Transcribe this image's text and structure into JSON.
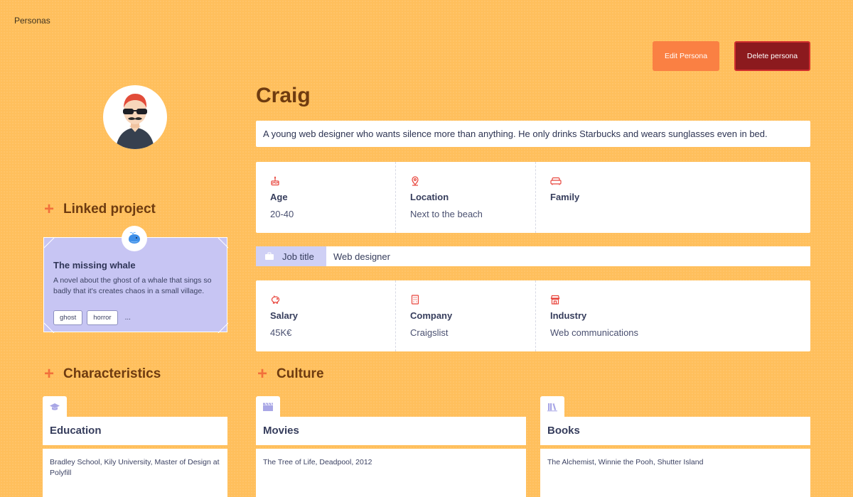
{
  "app": {
    "title": "Personas"
  },
  "actions": {
    "edit_label": "Edit Persona",
    "delete_label": "Delete persona"
  },
  "persona": {
    "name": "Craig",
    "description": "A young web designer who wants silence more than anything. He only drinks Starbucks and wears sunglasses even in bed.",
    "age": {
      "label": "Age",
      "value": "20-40",
      "icon": "cake-icon"
    },
    "location": {
      "label": "Location",
      "value": "Next to the beach",
      "icon": "location-pin-icon"
    },
    "family": {
      "label": "Family",
      "value": "",
      "icon": "sofa-icon"
    },
    "job": {
      "label": "Job title",
      "value": "Web designer",
      "icon": "briefcase-icon"
    },
    "salary": {
      "label": "Salary",
      "value": "45K€",
      "icon": "piggy-bank-icon"
    },
    "company": {
      "label": "Company",
      "value": "Craigslist",
      "icon": "building-icon"
    },
    "industry": {
      "label": "Industry",
      "value": "Web communications",
      "icon": "storefront-icon"
    }
  },
  "linked_project": {
    "heading": "Linked project",
    "title": "The missing whale",
    "description": "A novel about the ghost of a whale that sings so badly that it's creates chaos in a small village.",
    "emoji_icon": "whale-icon",
    "tags": [
      "ghost",
      "horror"
    ],
    "more": "..."
  },
  "characteristics": {
    "heading": "Characteristics",
    "education": {
      "label": "Education",
      "value": "Bradley School, Kily University, Master of Design at Polyfill",
      "icon": "graduation-cap-icon"
    }
  },
  "culture": {
    "heading": "Culture",
    "movies": {
      "label": "Movies",
      "value": "The Tree of Life, Deadpool, 2012",
      "icon": "clapperboard-icon"
    },
    "books": {
      "label": "Books",
      "value": "The Alchemist, Winnie the Pooh, Shutter Island",
      "icon": "books-icon"
    }
  },
  "colors": {
    "background": "#ffbf5c",
    "accent": "#fa8043",
    "danger": "#8c1a1e",
    "heading": "#6e3b10",
    "project_card": "#c7c5f3",
    "icon_red": "#e8453c",
    "icon_lavender": "#a9a7e6"
  }
}
